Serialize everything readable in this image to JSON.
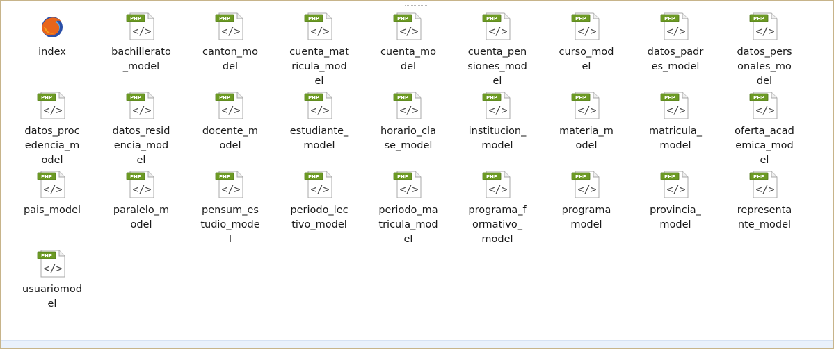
{
  "window": {
    "files": [
      {
        "name": "index",
        "type": "firefox"
      },
      {
        "name": "bachillerato_model",
        "type": "php"
      },
      {
        "name": "canton_model",
        "type": "php"
      },
      {
        "name": "cuenta_matricula_model",
        "type": "php"
      },
      {
        "name": "cuenta_model",
        "type": "php"
      },
      {
        "name": "cuenta_pensiones_model",
        "type": "php"
      },
      {
        "name": "curso_model",
        "type": "php"
      },
      {
        "name": "datos_padres_model",
        "type": "php"
      },
      {
        "name": "datos_personales_model",
        "type": "php"
      },
      {
        "name": "datos_procedencia_model",
        "type": "php"
      },
      {
        "name": "datos_residencia_model",
        "type": "php"
      },
      {
        "name": "docente_model",
        "type": "php"
      },
      {
        "name": "estudiante_model",
        "type": "php"
      },
      {
        "name": "horario_clase_model",
        "type": "php"
      },
      {
        "name": "institucion_model",
        "type": "php"
      },
      {
        "name": "materia_model",
        "type": "php"
      },
      {
        "name": "matricula_model",
        "type": "php"
      },
      {
        "name": "oferta_academica_model",
        "type": "php"
      },
      {
        "name": "pais_model",
        "type": "php"
      },
      {
        "name": "paralelo_model",
        "type": "php"
      },
      {
        "name": "pensum_estudio_model",
        "type": "php"
      },
      {
        "name": "periodo_lectivo_model",
        "type": "php"
      },
      {
        "name": "periodo_matricula_model",
        "type": "php"
      },
      {
        "name": "programa_formativo_model",
        "type": "php"
      },
      {
        "name": "programa model",
        "type": "php"
      },
      {
        "name": "provincia_model",
        "type": "php"
      },
      {
        "name": "representante_model",
        "type": "php"
      },
      {
        "name": "usuariomodel",
        "type": "php"
      }
    ]
  },
  "icons": {
    "php_badge_text": "PHP",
    "php_code_glyph": "</>",
    "php_badge_color": "#6c9a24",
    "firefox_icon": "firefox-icon",
    "php_icon": "php-file-icon"
  }
}
